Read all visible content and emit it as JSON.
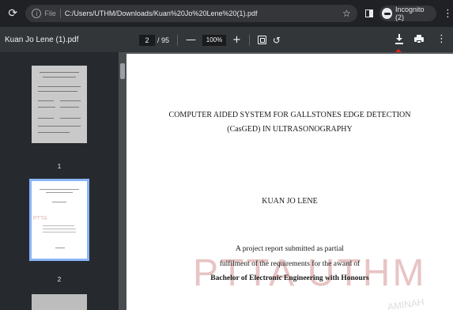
{
  "browser": {
    "reload_icon": "reload-icon",
    "info_icon_glyph": "i",
    "file_label": "File",
    "url": "C:/Users/UTHM/Downloads/Kuan%20Jo%20Lene%20(1).pdf",
    "incognito_label": "Incognito (2)"
  },
  "pdf_toolbar": {
    "doc_title": "Kuan Jo Lene (1).pdf",
    "page_current": "2",
    "page_total": "/ 95",
    "zoom_out": "—",
    "zoom_value": "100%",
    "zoom_in": "+"
  },
  "thumbnails": [
    {
      "label": "1"
    },
    {
      "label": "2"
    }
  ],
  "document": {
    "title_line1": "COMPUTER AIDED SYSTEM FOR GALLSTONES EDGE DETECTION",
    "title_line2": "(CasGED) IN ULTRASONOGRAPHY",
    "author": "KUAN JO LENE",
    "line_a": "A project report submitted as partial",
    "line_b": "fulfilment of the requirements for the award of",
    "line_c": "Bachelor of Electronic Engineering with Honours",
    "watermark": "PTTA UTHM",
    "watermark_small": "AMINAH"
  },
  "colors": {
    "annotation_arrow": "#e0201c",
    "selected_thumb_border": "#8ab4f8"
  }
}
